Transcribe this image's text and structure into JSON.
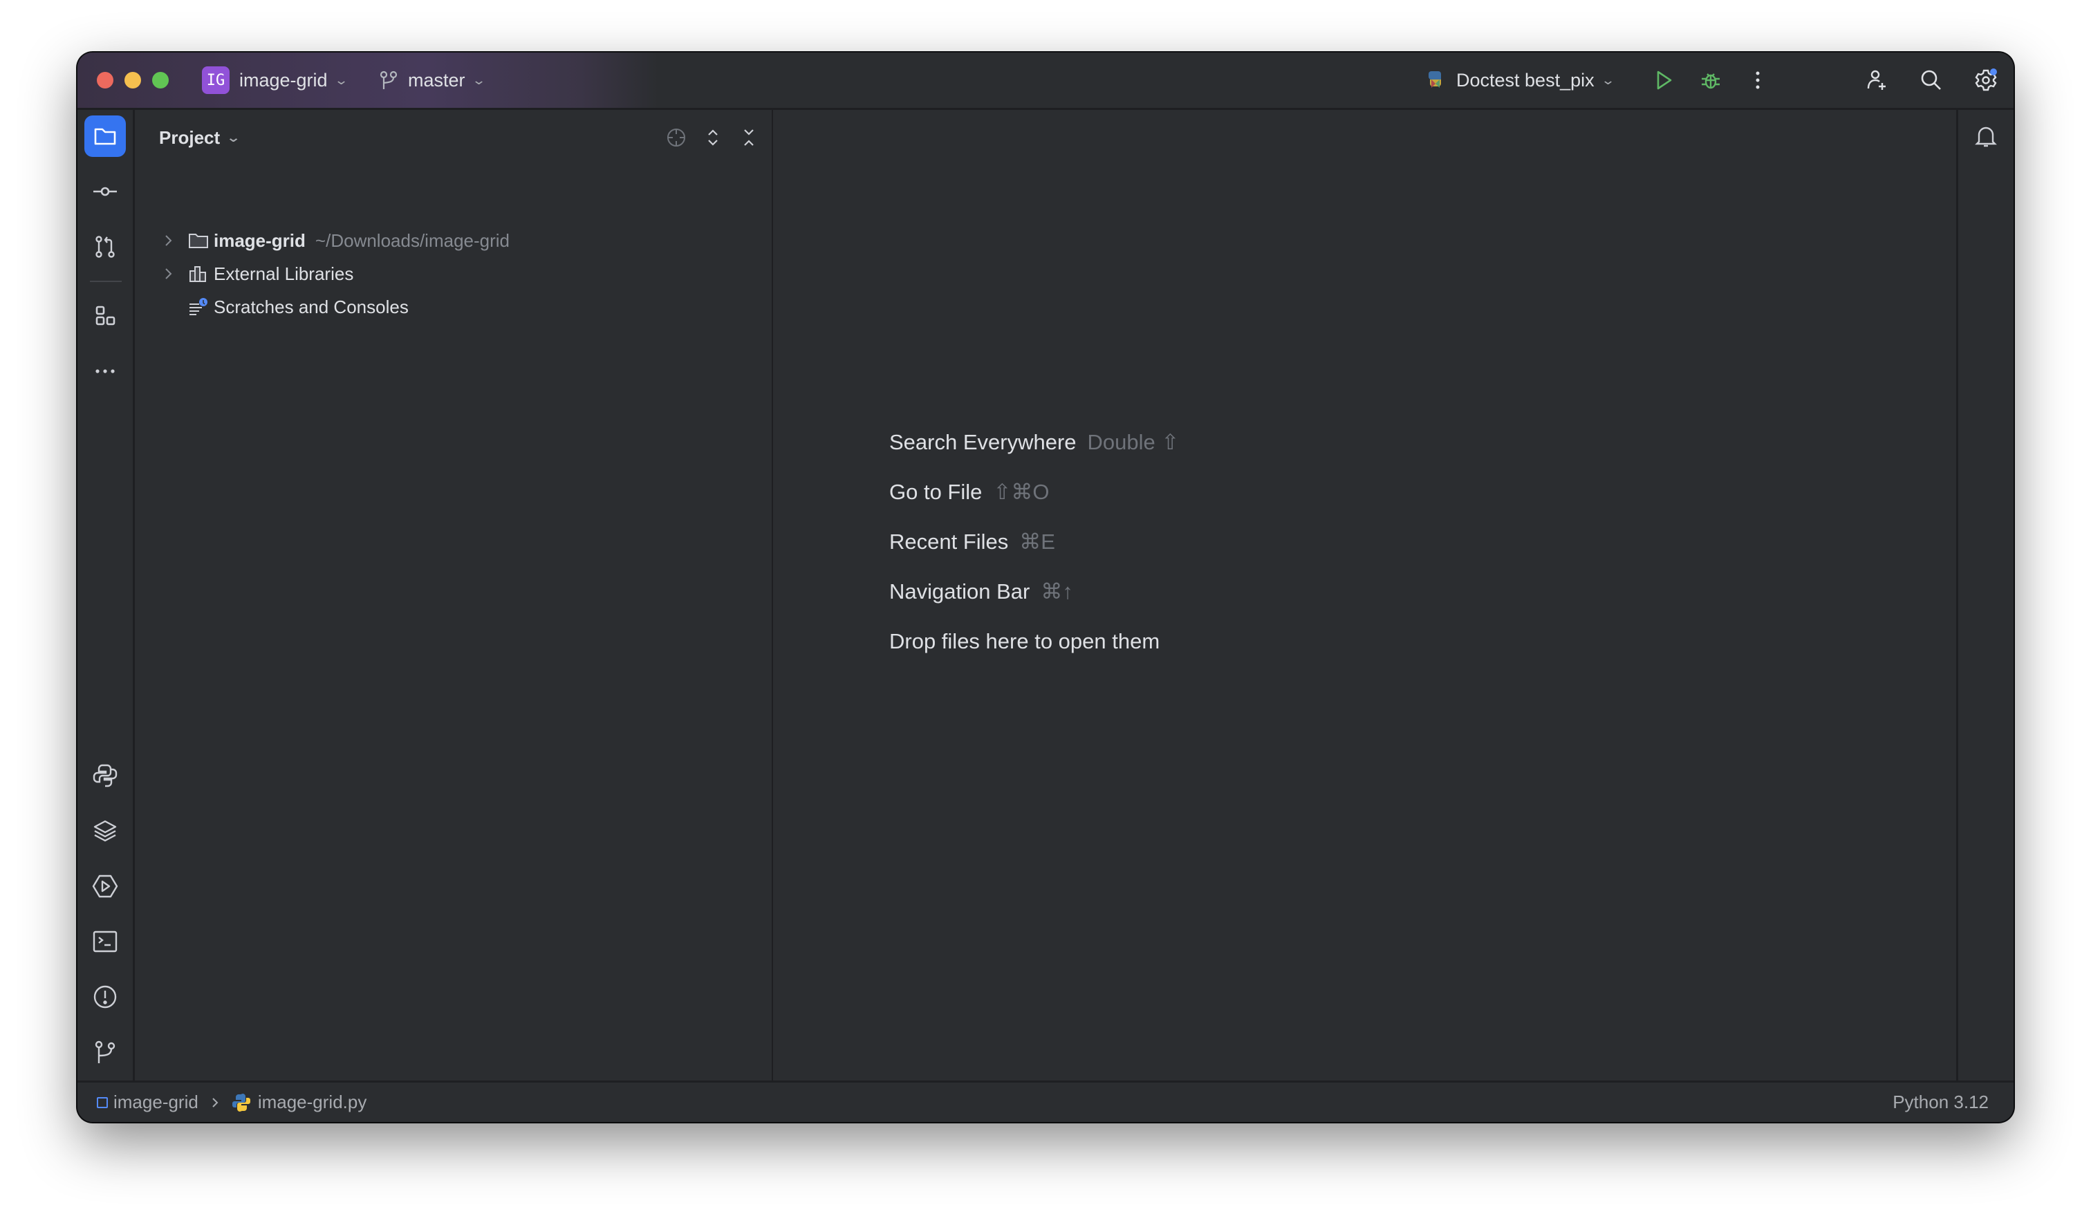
{
  "window": {
    "traffic_lights": [
      "close",
      "minimize",
      "maximize"
    ]
  },
  "titlebar": {
    "project_badge": "IG",
    "project_name": "image-grid",
    "branch_name": "master",
    "run_config": "Doctest best_pix",
    "icons": [
      "run-icon",
      "debug-icon",
      "more-icon",
      "add-user-icon",
      "search-icon",
      "settings-icon"
    ],
    "colors": {
      "project_badge": "#9152d8",
      "run": "#5fb865",
      "settings_dot": "#548af7"
    }
  },
  "left_stripe": {
    "top": [
      {
        "name": "project",
        "active": true
      },
      {
        "name": "commit"
      },
      {
        "name": "pull-requests"
      },
      {
        "name": "structure"
      },
      {
        "name": "more"
      }
    ],
    "bottom": [
      {
        "name": "python-console"
      },
      {
        "name": "python-packages"
      },
      {
        "name": "services"
      },
      {
        "name": "terminal"
      },
      {
        "name": "problems"
      },
      {
        "name": "version-control"
      }
    ],
    "active_color": "#3574f0"
  },
  "project_panel": {
    "title": "Project",
    "tree": [
      {
        "label": "image-grid",
        "path": "~/Downloads/image-grid",
        "expandable": true,
        "icon": "folder-icon"
      },
      {
        "label": "External Libraries",
        "expandable": true,
        "icon": "libraries-icon"
      },
      {
        "label": "Scratches and Consoles",
        "expandable": false,
        "icon": "scratches-icon"
      }
    ]
  },
  "editor": {
    "hints": [
      {
        "label": "Search Everywhere",
        "shortcut": "Double ⇧"
      },
      {
        "label": "Go to File",
        "shortcut": "⇧⌘O"
      },
      {
        "label": "Recent Files",
        "shortcut": "⌘E"
      },
      {
        "label": "Navigation Bar",
        "shortcut": "⌘↑"
      },
      {
        "label": "Drop files here to open them",
        "shortcut": ""
      }
    ]
  },
  "statusbar": {
    "breadcrumb": [
      "image-grid",
      "image-grid.py"
    ],
    "interpreter": "Python 3.12"
  }
}
